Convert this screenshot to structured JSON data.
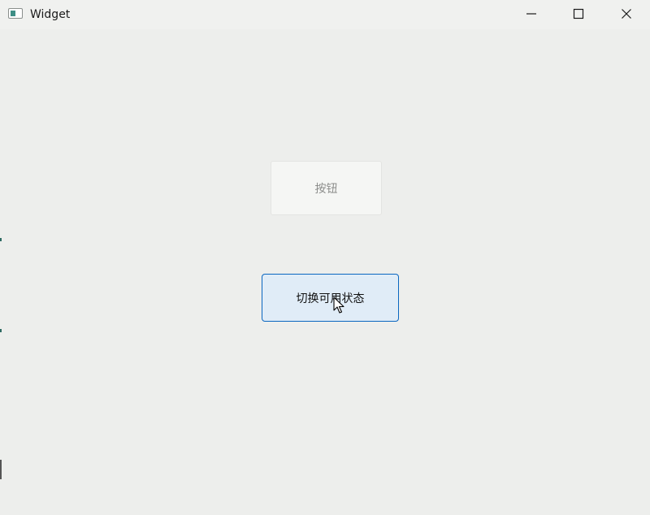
{
  "window": {
    "title": "Widget",
    "icon": "app-window-icon"
  },
  "titlebar_controls": {
    "minimize": "minimize-icon",
    "maximize": "maximize-icon",
    "close": "close-icon"
  },
  "main": {
    "disabled_button_label": "按钮",
    "toggle_button_label": "切换可用状态"
  },
  "colors": {
    "background": "#edeeec",
    "toggle_border": "#0a66c0",
    "toggle_fill": "#e0ecf7",
    "disabled_text": "#8b8c8a"
  }
}
